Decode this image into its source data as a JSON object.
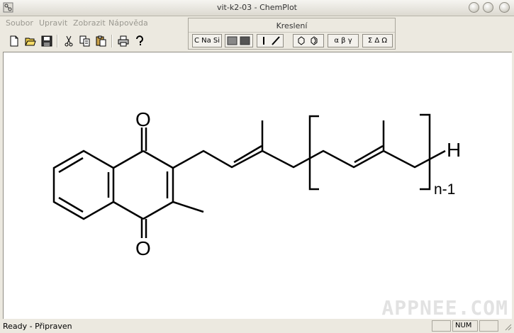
{
  "window": {
    "title": "vit-k2-03 - ChemPlot"
  },
  "menu": {
    "items": [
      "Soubor",
      "Upravit",
      "Zobrazit",
      "Nápověda"
    ]
  },
  "toolbar": {
    "buttons": [
      "new-file-icon",
      "open-folder-icon",
      "save-icon",
      "cut-icon",
      "copy-icon",
      "paste-icon",
      "print-icon",
      "help-icon"
    ]
  },
  "kreslen": {
    "title": "Kreslení",
    "elements_label": "C Na Si",
    "greek_label": "α β γ",
    "symbols_label": "Σ Δ Ω"
  },
  "molecule": {
    "atom_o_top": "O",
    "atom_o_bottom": "O",
    "atom_h": "H",
    "repeat_label": "n-1"
  },
  "status": {
    "text": "Ready - Připraven",
    "num": "NUM"
  },
  "watermark": "APPNEE.COM"
}
